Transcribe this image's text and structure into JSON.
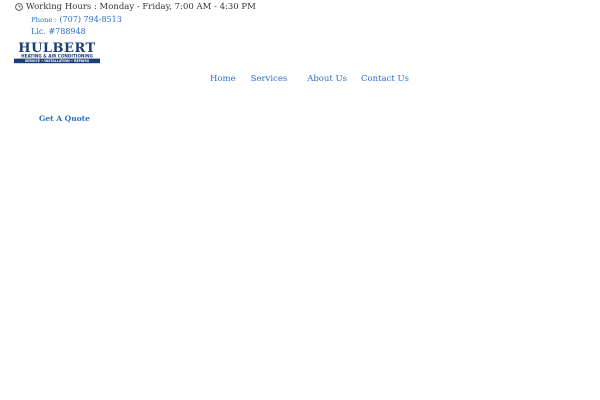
{
  "header": {
    "working_hours": "Working Hours : Monday - Friday, 7:00 AM - 4:30 PM",
    "phone_label": "Phone :",
    "phone_number": "(707) 794-8513",
    "license": "Lic. #788948"
  },
  "logo": {
    "name": "HULBERT",
    "subtitle": "HEATING & AIR CONDITIONING",
    "tagline": "SERVICE • INSTALLATION • REPAIRS",
    "color": "#1a3e73"
  },
  "nav": {
    "home": "Home",
    "services": "Services",
    "about": "About Us",
    "contact": "Contact Us"
  },
  "cta": {
    "quote": "Get A Quote"
  },
  "colors": {
    "link": "#2b6fc2",
    "text": "#333333",
    "brand": "#1a3e73"
  }
}
